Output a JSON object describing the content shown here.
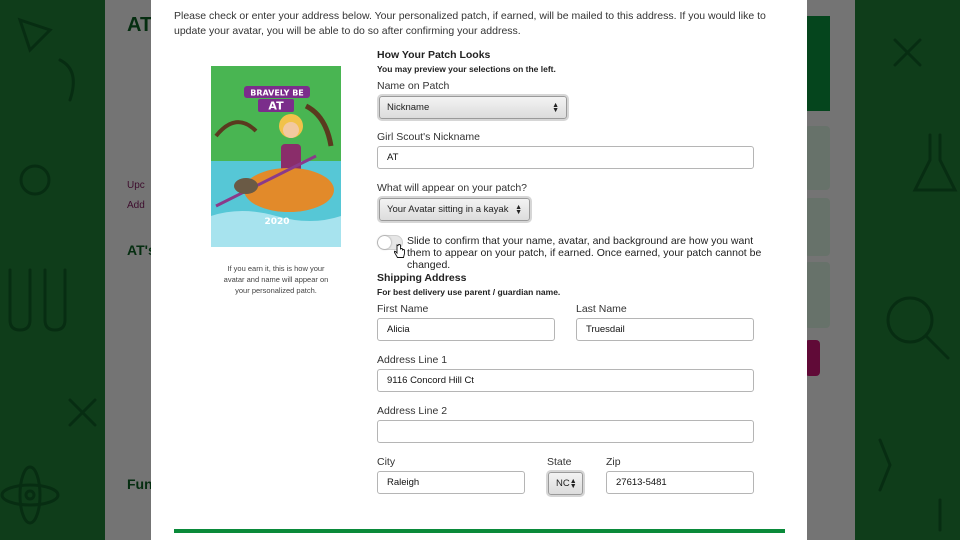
{
  "background": {
    "title_fragment": "AT",
    "links": [
      "Upc",
      "Add"
    ],
    "heading_fragment": "AT's",
    "footer_fragment": "Fun"
  },
  "modal": {
    "intro": "Please check or enter your address below. Your personalized patch, if earned, will be mailed to this address. If you would like to update your avatar, you will be able to do so after confirming your address.",
    "patch": {
      "banner_line1": "BRAVELY BE",
      "banner_line2": "AT",
      "year": "2020",
      "caption": "If you earn it, this is how your avatar and name will appear on your personalized patch."
    },
    "patch_section": {
      "title": "How Your Patch Looks",
      "subtitle": "You may preview your selections on the left.",
      "name_label": "Name on Patch",
      "name_value": "Nickname",
      "nickname_label": "Girl Scout's Nickname",
      "nickname_value": "AT",
      "appear_label": "What will appear on your patch?",
      "appear_value": "Your Avatar sitting in a kayak",
      "confirm_text": "Slide to confirm that your name, avatar, and background are how you want them to appear on your patch, if earned. Once earned, your patch cannot be changed."
    },
    "shipping": {
      "title": "Shipping Address",
      "subtitle": "For best delivery use parent / guardian name.",
      "first_name_label": "First Name",
      "first_name_value": "Alicia",
      "last_name_label": "Last Name",
      "last_name_value": "Truesdail",
      "address1_label": "Address Line 1",
      "address1_value": "9116 Concord Hill Ct",
      "address2_label": "Address Line 2",
      "address2_value": "",
      "city_label": "City",
      "city_value": "Raleigh",
      "state_label": "State",
      "state_value": "NC",
      "zip_label": "Zip",
      "zip_value": "27613-5481"
    }
  },
  "colors": {
    "brand_green": "#0a8a3a",
    "accent_pink": "#c0146e",
    "modal_bg": "#ffffff"
  }
}
